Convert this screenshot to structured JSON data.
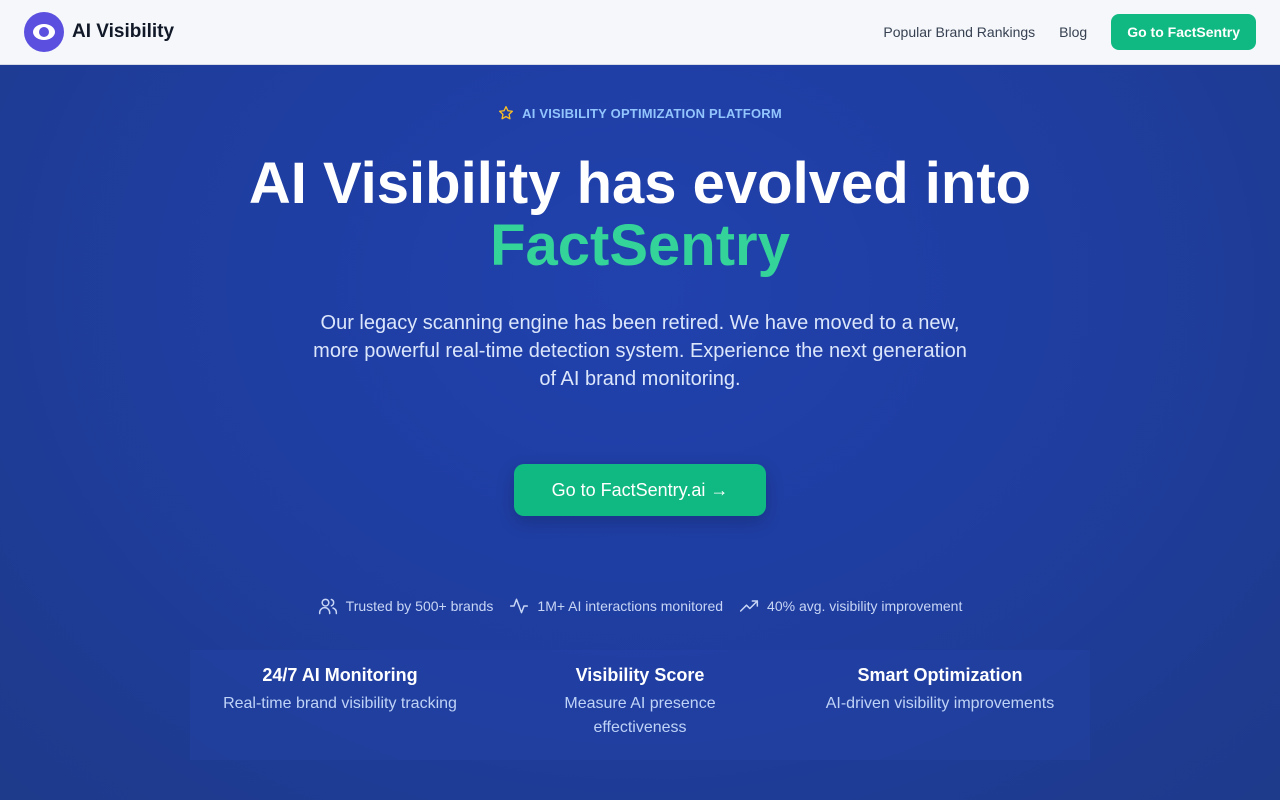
{
  "header": {
    "brand_name": "AI Visibility",
    "nav": {
      "rankings_label": "Popular Brand Rankings",
      "blog_label": "Blog",
      "cta_label": "Go to FactSentry"
    }
  },
  "hero": {
    "eyebrow": "AI VISIBILITY OPTIMIZATION PLATFORM",
    "title_line1": "AI Visibility has evolved into",
    "title_line2": "FactSentry",
    "subtitle": "Our legacy scanning engine has been retired. We have moved to a new, more powerful real-time detection system. Experience the next generation of AI brand monitoring.",
    "cta_label": "Go to FactSentry.ai →"
  },
  "stats": [
    {
      "icon": "users-icon",
      "label": "Trusted by 500+ brands"
    },
    {
      "icon": "activity-icon",
      "label": "1M+ AI interactions monitored"
    },
    {
      "icon": "trending-up-icon",
      "label": "40% avg. visibility improvement"
    }
  ],
  "features": [
    {
      "title": "24/7 AI Monitoring",
      "desc": "Real-time brand visibility tracking"
    },
    {
      "title": "Visibility Score",
      "desc": "Measure AI presence effectiveness"
    },
    {
      "title": "Smart Optimization",
      "desc": "AI-driven visibility improvements"
    }
  ],
  "colors": {
    "accent_green": "#10b981",
    "accent_green_text": "#34d399",
    "hero_blue": "#1e3a8a",
    "logo_purple": "#5b4fe0"
  }
}
